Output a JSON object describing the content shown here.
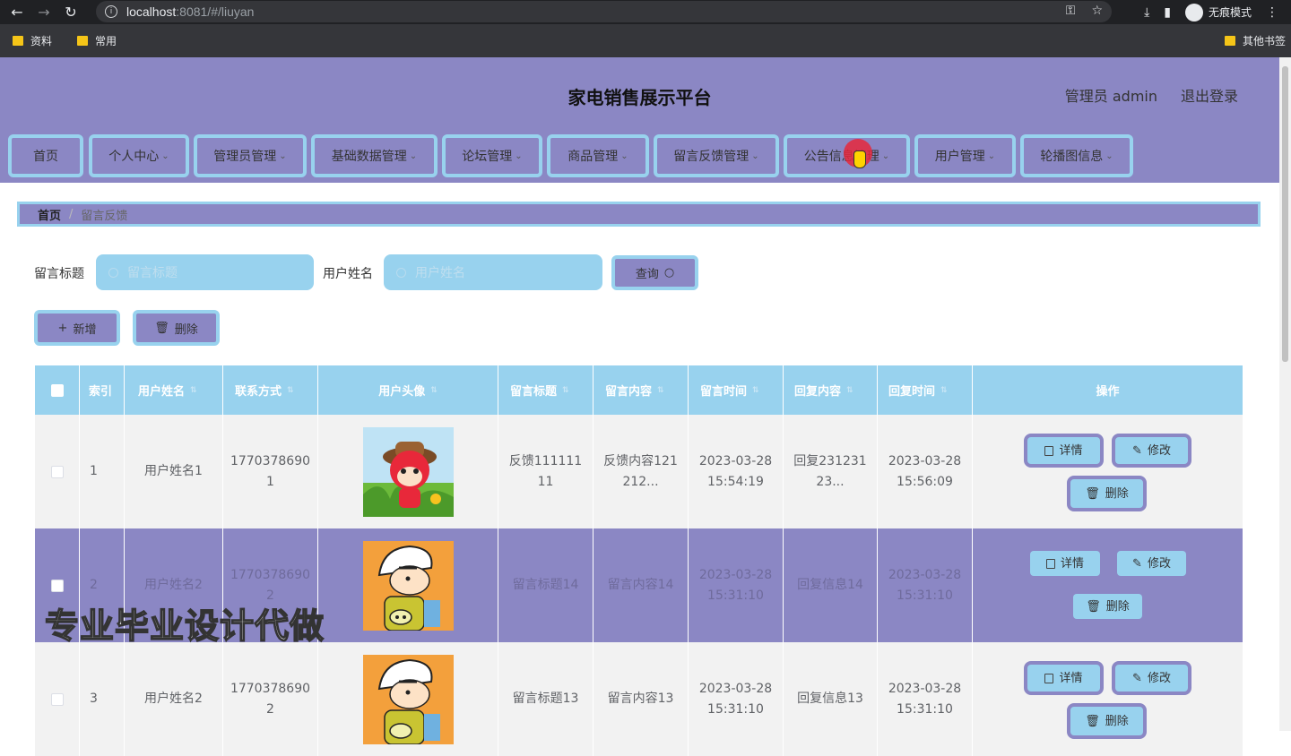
{
  "browser": {
    "url_host": "localhost",
    "url_rest": ":8081/#/liuyan",
    "incognito_label": "无痕模式",
    "bookmarks": [
      "资料",
      "常用"
    ],
    "other_bookmarks": "其他书签"
  },
  "header": {
    "title": "家电销售展示平台",
    "user": "管理员 admin",
    "logout": "退出登录"
  },
  "menu": [
    {
      "label": "首页",
      "dropdown": false
    },
    {
      "label": "个人中心",
      "dropdown": true
    },
    {
      "label": "管理员管理",
      "dropdown": true
    },
    {
      "label": "基础数据管理",
      "dropdown": true
    },
    {
      "label": "论坛管理",
      "dropdown": true
    },
    {
      "label": "商品管理",
      "dropdown": true
    },
    {
      "label": "留言反馈管理",
      "dropdown": true
    },
    {
      "label": "公告信息管理",
      "dropdown": true
    },
    {
      "label": "用户管理",
      "dropdown": true
    },
    {
      "label": "轮播图信息",
      "dropdown": true
    }
  ],
  "breadcrumb": {
    "home": "首页",
    "separator": "/",
    "current": "留言反馈"
  },
  "search": {
    "title_label": "留言标题",
    "title_placeholder": "留言标题",
    "name_label": "用户姓名",
    "name_placeholder": "用户姓名",
    "query_button": "查询"
  },
  "actions": {
    "add": "新增",
    "delete": "删除"
  },
  "table": {
    "columns": [
      "索引",
      "用户姓名",
      "联系方式",
      "用户头像",
      "留言标题",
      "留言内容",
      "留言时间",
      "回复内容",
      "回复时间",
      "操作"
    ],
    "rows": [
      {
        "index": "1",
        "name": "用户姓名1",
        "phone": [
          "1770378690",
          "1"
        ],
        "title": [
          "反馈111111",
          "11"
        ],
        "content": [
          "反馈内容121",
          "212..."
        ],
        "time": [
          "2023-03-28",
          "15:54:19"
        ],
        "reply": [
          "回复231231",
          "23..."
        ],
        "reply_time": [
          "2023-03-28",
          "15:56:09"
        ]
      },
      {
        "index": "2",
        "name": "用户姓名2",
        "phone": [
          "1770378690",
          "2"
        ],
        "title": [
          "留言标题14"
        ],
        "content": [
          "留言内容14"
        ],
        "time": [
          "2023-03-28",
          "15:31:10"
        ],
        "reply": [
          "回复信息14"
        ],
        "reply_time": [
          "2023-03-28",
          "15:31:10"
        ]
      },
      {
        "index": "3",
        "name": "用户姓名2",
        "phone": [
          "1770378690",
          "2"
        ],
        "title": [
          "留言标题13"
        ],
        "content": [
          "留言内容13"
        ],
        "time": [
          "2023-03-28",
          "15:31:10"
        ],
        "reply": [
          "回复信息13"
        ],
        "reply_time": [
          "2023-03-28",
          "15:31:10"
        ]
      }
    ],
    "op_labels": {
      "detail": "详情",
      "edit": "修改",
      "delete": "删除"
    }
  },
  "watermark": "专业毕业设计代做",
  "colors": {
    "purple": "#8b87c4",
    "light_blue": "#98d2ee"
  }
}
